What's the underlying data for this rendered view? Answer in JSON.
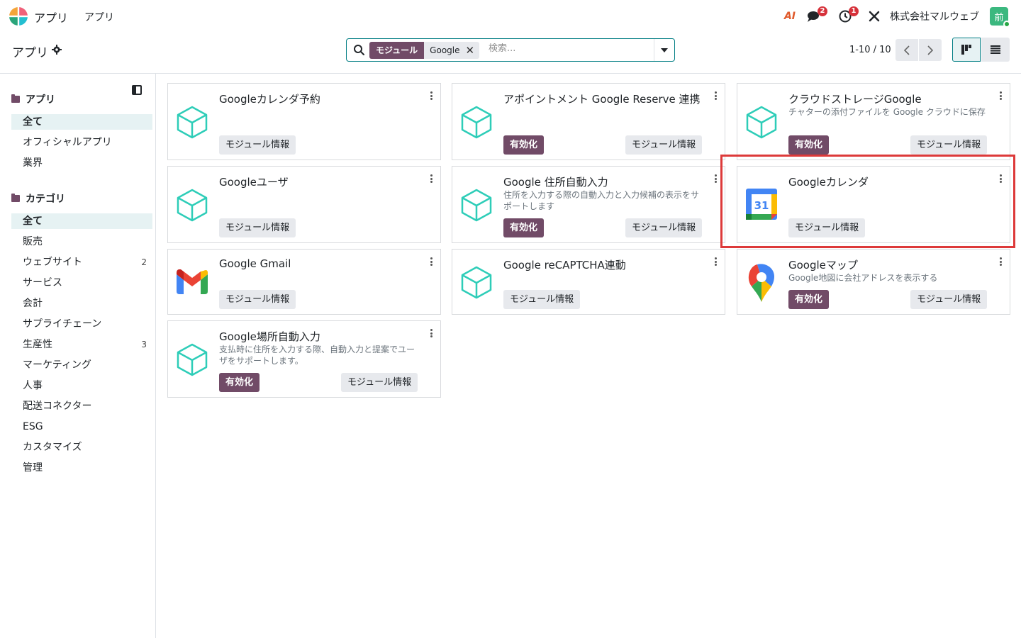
{
  "topbar": {
    "app_name": "アプリ",
    "menu_apps": "アプリ",
    "ai_label": "AI",
    "messages_badge": "2",
    "activities_badge": "1",
    "company": "株式会社マルウェブ",
    "avatar_initial": "前"
  },
  "control": {
    "page_title": "アプリ",
    "search": {
      "facet_label": "モジュール",
      "facet_value": "Google",
      "placeholder": "検索..."
    },
    "pager": "1-10 / 10"
  },
  "sidebar": {
    "apps_heading": "アプリ",
    "apps_items": [
      {
        "label": "全て"
      },
      {
        "label": "オフィシャルアプリ"
      },
      {
        "label": "業界"
      }
    ],
    "category_heading": "カテゴリ",
    "category_items": [
      {
        "label": "全て"
      },
      {
        "label": "販売"
      },
      {
        "label": "ウェブサイト",
        "count": "2"
      },
      {
        "label": "サービス"
      },
      {
        "label": "会計"
      },
      {
        "label": "サプライチェーン"
      },
      {
        "label": "生産性",
        "count": "3"
      },
      {
        "label": "マーケティング"
      },
      {
        "label": "人事"
      },
      {
        "label": "配送コネクター"
      },
      {
        "label": "ESG"
      },
      {
        "label": "カスタマイズ"
      },
      {
        "label": "管理"
      }
    ]
  },
  "buttons": {
    "activate": "有効化",
    "module_info": "モジュール情報"
  },
  "cards": [
    {
      "title": "Googleカレンダ予約",
      "desc": ""
    },
    {
      "title": "アポイントメント Google Reserve 連携",
      "desc": ""
    },
    {
      "title": "クラウドストレージGoogle",
      "desc": "チャターの添付ファイルを Google クラウドに保存"
    },
    {
      "title": "Googleユーザ",
      "desc": ""
    },
    {
      "title": "Google 住所自動入力",
      "desc": "住所を入力する際の自動入力と入力候補の表示をサポートします"
    },
    {
      "title": "Googleカレンダ",
      "desc": "",
      "calendar_day": "31"
    },
    {
      "title": "Google Gmail",
      "desc": ""
    },
    {
      "title": "Google reCAPTCHA連動",
      "desc": ""
    },
    {
      "title": "Googleマップ",
      "desc": "Google地図に会社アドレスを表示する"
    },
    {
      "title": "Google場所自動入力",
      "desc": "支払時に住所を入力する際、自動入力と提案でユーザをサポートします。"
    }
  ],
  "colors": {
    "primary": "#714b67",
    "accent": "#017e84",
    "module_icon": "#2ecdb8",
    "highlight": "#dd3a3a"
  }
}
